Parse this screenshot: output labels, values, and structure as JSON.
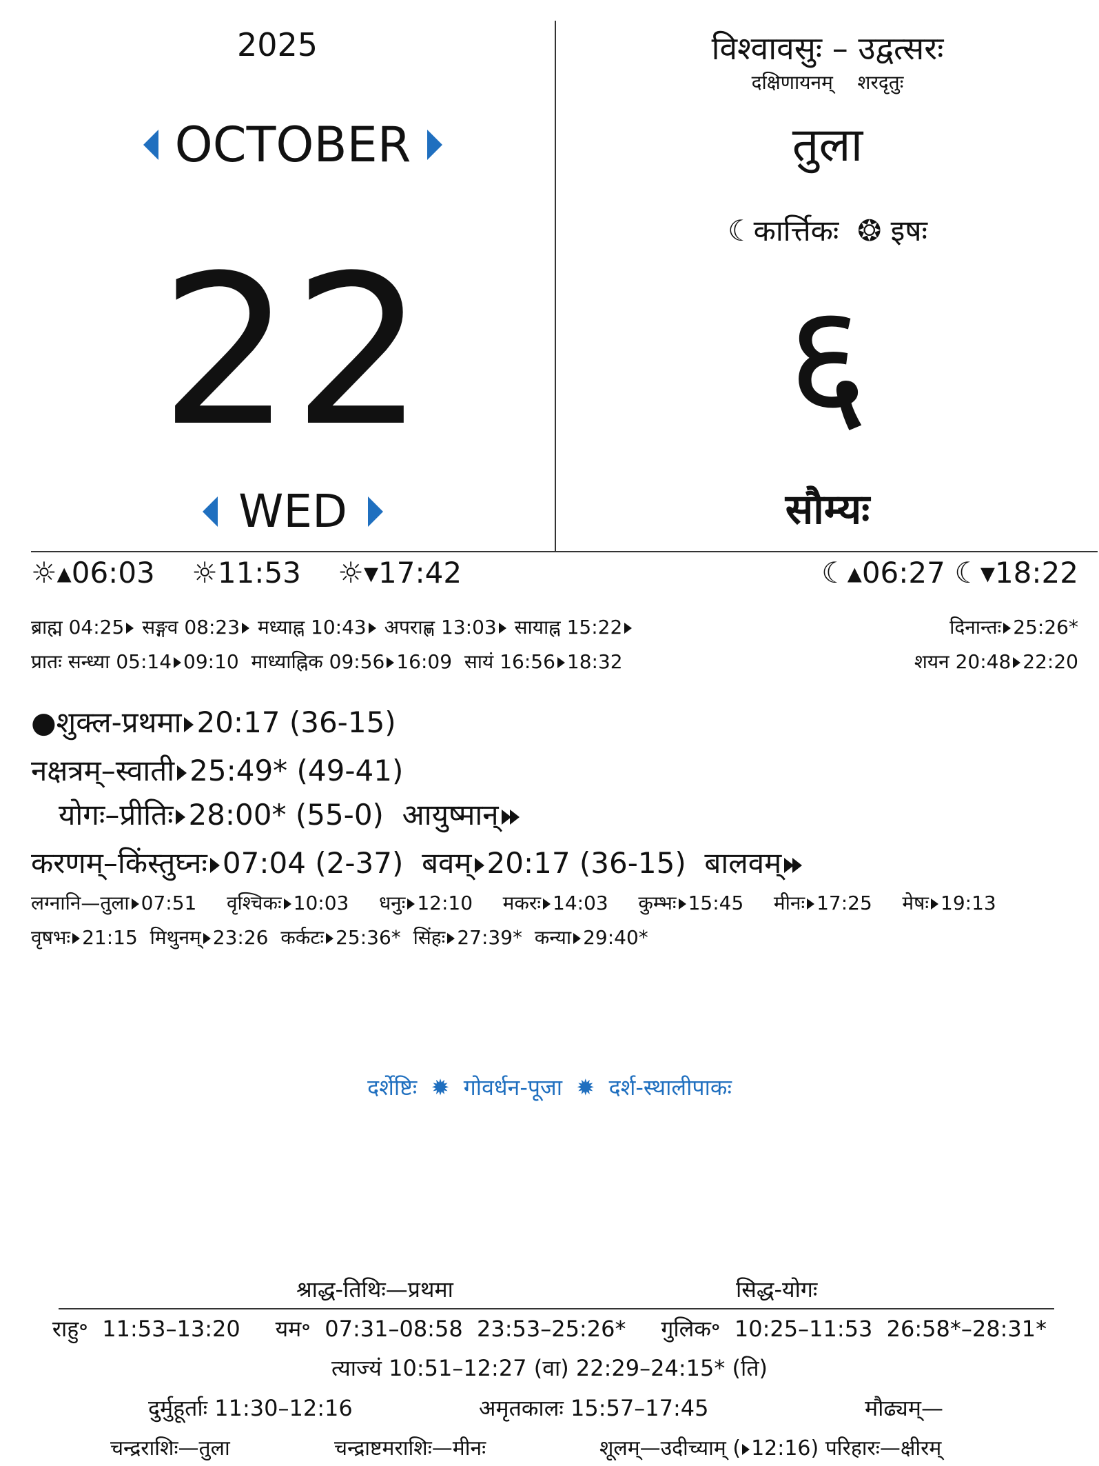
{
  "left": {
    "year": "2025",
    "month": "OCTOBER",
    "day": "22",
    "weekday": "WED"
  },
  "right": {
    "samvatsara": "विश्वावसुः – उद्वत्सरः",
    "ayana": "दक्षिणायनम्",
    "ritu": "शरदृतुः",
    "rashi": "तुला",
    "lunar_month": "कार्त्तिकः",
    "solar_month": "इषः",
    "solar_day": "६",
    "vara": "सौम्यः"
  },
  "times": {
    "sunrise": "06:03",
    "noon": "11:53",
    "sunset": "17:42",
    "moonrise": "06:27",
    "moonset": "18:22"
  },
  "muhurta_row1": [
    {
      "label": "ब्राह्म",
      "time": "04:25"
    },
    {
      "label": "सङ्गव",
      "time": "08:23"
    },
    {
      "label": "मध्याह्न",
      "time": "10:43"
    },
    {
      "label": "अपराह्ण",
      "time": "13:03"
    },
    {
      "label": "सायाह्न",
      "time": "15:22"
    }
  ],
  "dinanta": {
    "label": "दिनान्तः",
    "time": "25:26*"
  },
  "sandhya": {
    "pratah_label": "प्रातः सन्ध्या",
    "pratah_start": "05:14",
    "pratah_end": "09:10",
    "madhya_label": "माध्याह्निक",
    "madhya_start": "09:56",
    "madhya_end": "16:09",
    "sayam_label": "सायं",
    "sayam_start": "16:56",
    "sayam_end": "18:32",
    "shayana_label": "शयन",
    "shayana_start": "20:48",
    "shayana_end": "22:20"
  },
  "panchanga": {
    "tithi_name": "शुक्ल-प्रथमा",
    "tithi_time": "20:17 (36-15)",
    "nakshatra_name": "नक्षत्रम्–स्वाती",
    "nakshatra_time": "25:49* (49-41)",
    "yoga_name": "योगः–प्रीतिः",
    "yoga_time": "28:00* (55-0)",
    "yoga_next": "आयुष्मान्",
    "karana_name": "करणम्–किंस्तुघ्नः",
    "karana_time": "07:04 (2-37)",
    "karana2_name": "बवम्",
    "karana2_time": "20:17 (36-15)",
    "karana_next": "बालवम्"
  },
  "lagnas_row1": [
    {
      "name": "लग्नानि—तुला",
      "time": "07:51"
    },
    {
      "name": "वृश्चिकः",
      "time": "10:03"
    },
    {
      "name": "धनुः",
      "time": "12:10"
    },
    {
      "name": "मकरः",
      "time": "14:03"
    },
    {
      "name": "कुम्भः",
      "time": "15:45"
    },
    {
      "name": "मीनः",
      "time": "17:25"
    },
    {
      "name": "मेषः",
      "time": "19:13"
    }
  ],
  "lagnas_row2": [
    {
      "name": "वृषभः",
      "time": "21:15"
    },
    {
      "name": "मिथुनम्",
      "time": "23:26"
    },
    {
      "name": "कर्कटः",
      "time": "25:36*"
    },
    {
      "name": "सिंहः",
      "time": "27:39*"
    },
    {
      "name": "कन्या",
      "time": "29:40*"
    }
  ],
  "festivals": [
    "दर्शेष्टिः",
    "गोवर्धन-पूजा",
    "दर्श-स्थालीपाकः"
  ],
  "bottom": {
    "shraddha": "श्राद्ध-तिथिः—प्रथमा",
    "siddha": "सिद्ध-योगः",
    "rahu_label": "राहु॰",
    "rahu_time": "11:53–13:20",
    "yama_label": "यम॰",
    "yama_time": "07:31–08:58  23:53–25:26*",
    "gulika_label": "गुलिक॰",
    "gulika_time": "10:25–11:53  26:58*–28:31*",
    "tyajya": "त्याज्यं 10:51–12:27 (वा) 22:29–24:15* (ति)",
    "durmuhurta": "दुर्मुहूर्ताः 11:30–12:16",
    "amritakala": "अमृतकालः 15:57–17:45",
    "maudhya": "मौढ्यम्—",
    "chandra_rashi": "चन्द्रराशिः—तुला",
    "chandrashtama": "चन्द्राष्टमराशिः—मीनः",
    "shoolam": "शूलम्—उदीच्याम् (",
    "shoolam_time": "12:16) परिहारः—क्षीरम्"
  },
  "colors": {
    "accent": "#1f6fbf",
    "text": "#111111"
  },
  "icons": [
    "sun-rise-icon",
    "sun-noon-icon",
    "sun-set-icon",
    "moon-rise-icon",
    "moon-set-icon",
    "new-moon-dot-icon",
    "chakra-icon",
    "moon-crescent-icon",
    "flower-bullet-icon"
  ]
}
